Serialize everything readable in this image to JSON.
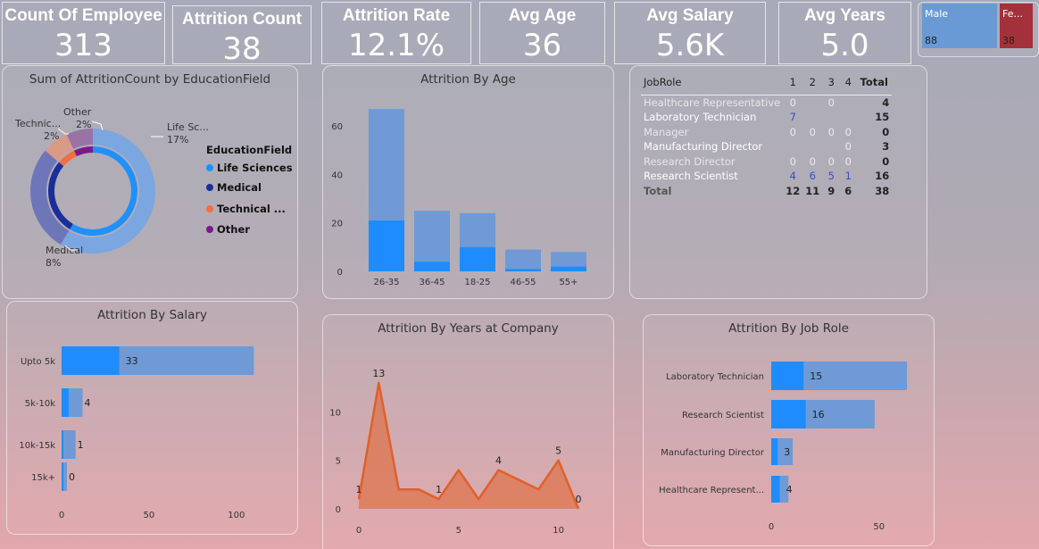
{
  "kpis": [
    {
      "label": "Count Of Employee",
      "value": "313"
    },
    {
      "label": "Attrition Count",
      "value": "38"
    },
    {
      "label": "Attrition Rate",
      "value": "12.1%"
    },
    {
      "label": "Avg Age",
      "value": "36"
    },
    {
      "label": "Avg Salary",
      "value": "5.6K"
    },
    {
      "label": "Avg Years",
      "value": "5.0"
    }
  ],
  "gender": {
    "male_label": "Male",
    "male_value": "88",
    "female_label": "Fe...",
    "female_value": "38",
    "colors": {
      "male": "#6a9ad4",
      "female": "#a3313b"
    }
  },
  "job_table": {
    "header": [
      "JobRole",
      "1",
      "2",
      "3",
      "4",
      "Total"
    ],
    "rows": [
      {
        "role": "Healthcare Representative",
        "v": [
          "0",
          "",
          "0",
          ""
        ],
        "total": "4"
      },
      {
        "role": "Laboratory Technician",
        "v": [
          "7",
          "",
          "",
          ""
        ],
        "total": "15"
      },
      {
        "role": "Manager",
        "v": [
          "0",
          "0",
          "0",
          "0"
        ],
        "total": "0"
      },
      {
        "role": "Manufacturing Director",
        "v": [
          "",
          "",
          "",
          "0"
        ],
        "total": "3"
      },
      {
        "role": "Research Director",
        "v": [
          "0",
          "0",
          "0",
          "0"
        ],
        "total": "0"
      },
      {
        "role": "Research Scientist",
        "v": [
          "4",
          "6",
          "5",
          "1"
        ],
        "total": "16"
      }
    ],
    "total_row": {
      "role": "Total",
      "v": [
        "12",
        "11",
        "9",
        "6"
      ],
      "total": "38"
    }
  },
  "chart_data": [
    {
      "type": "pie",
      "title": "Sum of AttritionCount by EducationField",
      "legend_title": "EducationField",
      "categories": [
        "Life Sciences",
        "Medical",
        "Technical ...",
        "Other"
      ],
      "slice_labels": [
        "Life Sc...",
        "Medical",
        "Technic...",
        "Other"
      ],
      "values": [
        17,
        8,
        2,
        2
      ],
      "value_labels": [
        "17%",
        "8%",
        "2%",
        "2%"
      ],
      "colors": [
        "#1e90ff",
        "#1c2e9a",
        "#f07040",
        "#7a1a8a"
      ]
    },
    {
      "type": "bar",
      "title": "Attrition By Age",
      "categories": [
        "26-35",
        "36-45",
        "18-25",
        "46-55",
        "55+"
      ],
      "series": [
        {
          "values": [
            67,
            25,
            24,
            9,
            8
          ]
        },
        {
          "values": [
            21,
            4,
            10,
            1,
            2
          ]
        }
      ],
      "ylim": [
        0,
        70
      ],
      "yticks": [
        0,
        20,
        40,
        60
      ]
    },
    {
      "type": "bar",
      "title": "Attrition By Salary",
      "categories": [
        "Upto 5k",
        "5k-10k",
        "10k-15k",
        "15k+"
      ],
      "series": [
        {
          "values": [
            110,
            12,
            8,
            3
          ]
        },
        {
          "values": [
            33,
            4,
            1,
            0
          ]
        }
      ],
      "data_labels": [
        "33",
        "4",
        "1",
        "0"
      ],
      "xlim": [
        0,
        120
      ],
      "xticks": [
        0,
        50,
        100
      ]
    },
    {
      "type": "area",
      "title": "Attrition By Years at Company",
      "x": [
        0,
        1,
        2,
        3,
        4,
        5,
        6,
        7,
        8,
        9,
        10,
        11
      ],
      "values": [
        1,
        13,
        2,
        2,
        1,
        4,
        1,
        4,
        3,
        2,
        5,
        0
      ],
      "data_labels": [
        {
          "x": 0,
          "text": "1"
        },
        {
          "x": 1,
          "text": "13"
        },
        {
          "x": 4,
          "text": "1"
        },
        {
          "x": 7,
          "text": "4"
        },
        {
          "x": 10,
          "text": "5"
        },
        {
          "x": 11,
          "text": "0"
        }
      ],
      "xlim": [
        0,
        11
      ],
      "ylim": [
        0,
        14
      ],
      "xticks": [
        0,
        5,
        10
      ],
      "yticks": [
        0,
        5,
        10
      ],
      "color": "#e0602a"
    },
    {
      "type": "bar",
      "title": "Attrition By Job Role",
      "categories": [
        "Laboratory Technician",
        "Research Scientist",
        "Manufacturing Director",
        "Healthcare Represent..."
      ],
      "series": [
        {
          "values": [
            63,
            48,
            10,
            8
          ]
        },
        {
          "values": [
            15,
            16,
            3,
            4
          ]
        }
      ],
      "data_labels": [
        "15",
        "16",
        "3",
        "4"
      ],
      "xlim": [
        0,
        70
      ],
      "xticks": [
        0,
        50
      ]
    }
  ]
}
